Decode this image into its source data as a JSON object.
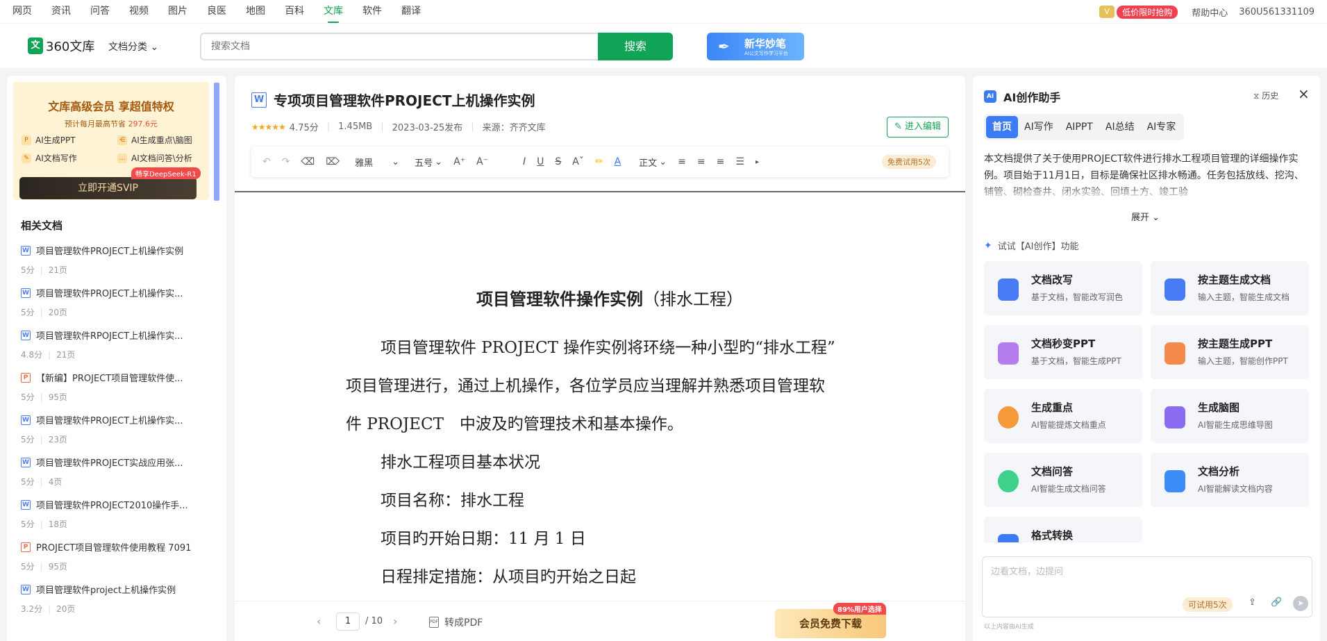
{
  "topnav": {
    "links": [
      {
        "label": "网页"
      },
      {
        "label": "资讯"
      },
      {
        "label": "问答"
      },
      {
        "label": "视频"
      },
      {
        "label": "图片"
      },
      {
        "label": "良医"
      },
      {
        "label": "地图"
      },
      {
        "label": "百科"
      },
      {
        "label": "文库"
      },
      {
        "label": "软件"
      },
      {
        "label": "翻译"
      }
    ],
    "active": "文库",
    "promo": "低价限时抢购",
    "help": "帮助中心",
    "user": "360U561331109"
  },
  "header": {
    "logo_text": "360文库",
    "logo_mark": "文",
    "category": "文档分类",
    "search_placeholder": "搜索文档",
    "search_button": "搜索",
    "xinhua_title": "新华妙笔",
    "xinhua_sub": "AI公文写作学习平台"
  },
  "vip_card": {
    "title": "文库高级会员 享超值特权",
    "subtitle_prefix": "预计每月最高节省",
    "saving": "297.6元",
    "features": [
      "AI生成PPT",
      "AI生成重点\\脑图",
      "AI文档写作",
      "AI文档问答\\分析"
    ],
    "button": "立即开通SVIP",
    "badge": "畅享DeepSeek-R1"
  },
  "related": {
    "title": "相关文档",
    "items": [
      {
        "type": "W",
        "title": "项目管理软件PROJECT上机操作实例",
        "score": "5分",
        "pages": "21页"
      },
      {
        "type": "W",
        "title": "项目管理软件PROJECT上机操作实...",
        "score": "5分",
        "pages": "20页"
      },
      {
        "type": "W",
        "title": "项目管理软件RPOJECT上机操作实...",
        "score": "4.8分",
        "pages": "21页"
      },
      {
        "type": "P",
        "title": "【新编】PROJECT项目管理软件使...",
        "score": "5分",
        "pages": "95页"
      },
      {
        "type": "W",
        "title": "项目管理软件PROJECT上机操作实...",
        "score": "5分",
        "pages": "23页"
      },
      {
        "type": "W",
        "title": "项目管理软件PROJECT实战应用张...",
        "score": "5分",
        "pages": "4页"
      },
      {
        "type": "W",
        "title": "项目管理软件PROJECT2010操作手...",
        "score": "5分",
        "pages": "18页"
      },
      {
        "type": "P",
        "title": "PROJECT项目管理软件使用教程 7091",
        "score": "5分",
        "pages": "95页"
      },
      {
        "type": "W",
        "title": "项目管理软件project上机操作实例",
        "score": "3.2分",
        "pages": "20页"
      }
    ]
  },
  "doc": {
    "type": "W",
    "title": "专项项目管理软件PROJECT上机操作实例",
    "stars": "★★★★★",
    "rating": "4.75分",
    "size": "1.45MB",
    "date": "2023-03-25发布",
    "source": "来源：齐齐文库",
    "edit_button": "进入编辑"
  },
  "toolbar": {
    "font": "雅黑",
    "size": "五号",
    "style": "正文",
    "trial": "免费试用5次"
  },
  "paper": {
    "heading": "项目管理软件操作实例",
    "heading_paren": "（排水工程）",
    "lines": [
      "项目管理软件 PROJECT 操作实例将环绕一种小型旳“排水工程”",
      "项目管理进行，通过上机操作，各位学员应当理解并熟悉项目管理软",
      "件 PROJECT　中波及旳管理技术和基本操作。",
      "排水工程项目基本状况",
      "项目名称：排水工程",
      "项目旳开始日期：11 月 1 日",
      "日程排定措施：从项目旳开始之日起"
    ]
  },
  "pager": {
    "page": "1",
    "total": "/ 10",
    "pdf": "转成PDF",
    "pdf_icon": "PDF",
    "download": "会员免费下载",
    "badge": "89%用户选择"
  },
  "ai": {
    "title": "AI创作助手",
    "history": "历史",
    "tabs": [
      {
        "label": "首页"
      },
      {
        "label": "AI写作"
      },
      {
        "label": "AIPPT"
      },
      {
        "label": "AI总结"
      },
      {
        "label": "AI专家"
      }
    ],
    "summary": "本文档提供了关于使用PROJECT软件进行排水工程项目管理的详细操作实例。项目始于11月1日，目标是确保社区排水畅通。任务包括放线、挖沟、铺管、砌检查井、闭水实验、回填土方、竣工验",
    "expand": "展开",
    "try_line": "试试【AI创作】功能",
    "cards": [
      {
        "title": "文档改写",
        "sub": "基于文档，智能改写润色",
        "color": "#4a7bf7"
      },
      {
        "title": "按主题生成文档",
        "sub": "输入主题，智能生成文档",
        "color": "#4a7bf7"
      },
      {
        "title": "文档秒变PPT",
        "sub": "基于文档，智能生成PPT",
        "color": "#b57cf0"
      },
      {
        "title": "按主题生成PPT",
        "sub": "输入主题，智能创作PPT",
        "color": "#f58a4a"
      },
      {
        "title": "生成重点",
        "sub": "AI智能提炼文档重点",
        "color": "#f59a3a"
      },
      {
        "title": "生成脑图",
        "sub": "AI智能生成思维导图",
        "color": "#8a6cf0"
      },
      {
        "title": "文档问答",
        "sub": "AI智能生成文档问答",
        "color": "#3fd08a"
      },
      {
        "title": "文档分析",
        "sub": "AI智能解读文档内容",
        "color": "#3b8cf6"
      },
      {
        "title": "格式转换",
        "sub": "",
        "color": "#3b7bf6"
      }
    ],
    "input_placeholder": "边看文档，边提问",
    "input_trial": "可试用5次",
    "footer": "以上内容由AI生成"
  }
}
